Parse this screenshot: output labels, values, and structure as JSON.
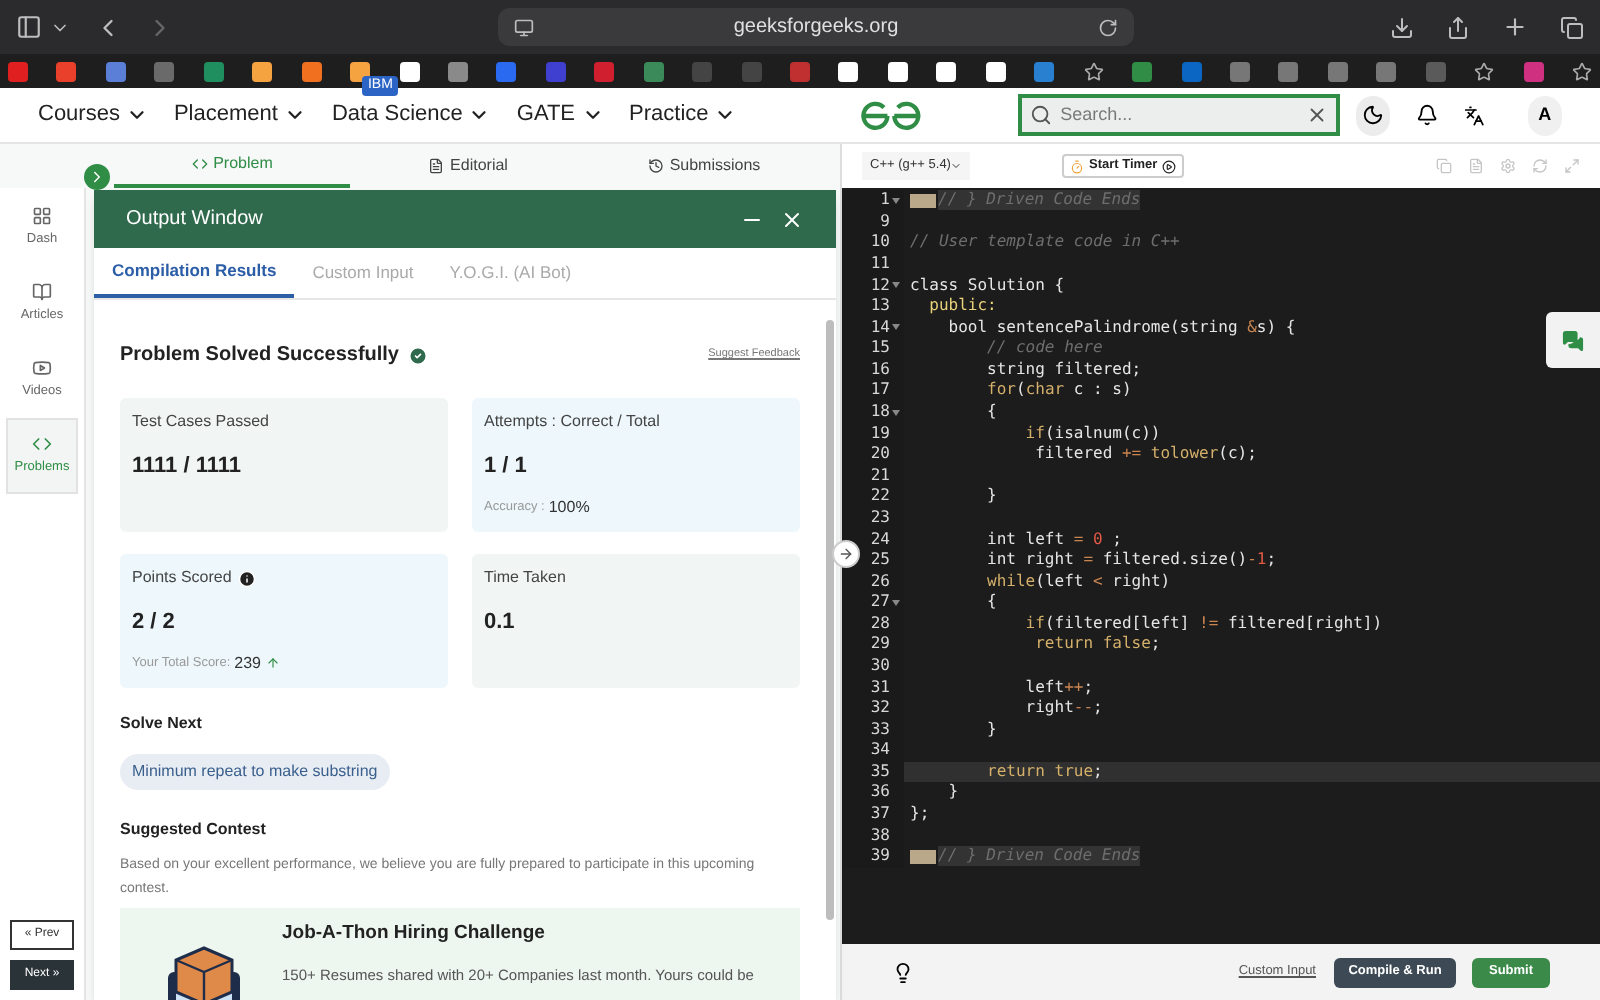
{
  "browser": {
    "url": "geeksforgeeks.org"
  },
  "nav": {
    "items": [
      {
        "label": "Courses"
      },
      {
        "label": "Placement"
      },
      {
        "label": "Data Science",
        "badge": "IBM"
      },
      {
        "label": "GATE"
      },
      {
        "label": "Practice"
      }
    ],
    "search": {
      "placeholder": "Search..."
    },
    "avatar": "A"
  },
  "problem_tabs": [
    {
      "label": "Problem",
      "selected": true
    },
    {
      "label": "Editorial",
      "selected": false
    },
    {
      "label": "Submissions",
      "selected": false
    }
  ],
  "sidebar": {
    "items": [
      {
        "label": "Dash",
        "selected": false
      },
      {
        "label": "Articles",
        "selected": false
      },
      {
        "label": "Videos",
        "selected": false
      },
      {
        "label": "Problems",
        "selected": true
      }
    ],
    "prev": "« Prev",
    "next": "Next »"
  },
  "output_window": {
    "title": "Output Window",
    "tabs": [
      {
        "label": "Compilation Results",
        "selected": true
      },
      {
        "label": "Custom Input",
        "selected": false
      },
      {
        "label": "Y.O.G.I. (AI Bot)",
        "selected": false
      }
    ],
    "heading": "Problem Solved Successfully",
    "feedback_link": "Suggest Feedback",
    "cards": [
      {
        "title": "Test Cases Passed",
        "value": "1111 / 1111",
        "color": "#f1f5f4"
      },
      {
        "title": "Attempts : Correct / Total",
        "value": "1 / 1",
        "note_label": "Accuracy :",
        "note_value": "100%",
        "color": "#eef8fc"
      },
      {
        "title": "Points Scored",
        "value": "2 / 2",
        "note_label": "Your Total Score:",
        "note_value": "239",
        "color": "#eef8fc"
      },
      {
        "title": "Time Taken",
        "value": "0.1",
        "color": "#f1f5f4"
      }
    ],
    "solve_next": {
      "heading": "Solve Next",
      "chip": "Minimum repeat to make substring"
    },
    "contest": {
      "heading": "Suggested Contest",
      "description": "Based on your excellent performance, we believe you are fully prepared to participate in this upcoming contest.",
      "title": "Job-A-Thon Hiring Challenge",
      "text": "150+ Resumes shared with 20+ Companies last month. Yours could be"
    }
  },
  "editor": {
    "language": "C++ (g++ 5.4)",
    "timer_button": "Start Timer",
    "lines": [
      {
        "number": "1",
        "fold": true,
        "folded": true,
        "current": false,
        "segments": [
          {
            "kind": "comment",
            "text": "// } Driven Code Ends"
          }
        ]
      },
      {
        "number": "9",
        "fold": false,
        "folded": false,
        "current": false
      },
      {
        "number": "10",
        "fold": false,
        "folded": false,
        "current": false,
        "segments": [
          {
            "kind": "comment",
            "text": "// User template code in C++"
          }
        ]
      },
      {
        "number": "11",
        "fold": false,
        "folded": false,
        "current": false
      },
      {
        "number": "12",
        "fold": true,
        "folded": false,
        "current": false,
        "segments": [
          {
            "kind": "text",
            "text": "class Solution {"
          }
        ]
      },
      {
        "number": "13",
        "fold": false,
        "folded": false,
        "current": false,
        "segments": [
          {
            "kind": "label",
            "text": "  public:"
          }
        ]
      },
      {
        "number": "14",
        "fold": true,
        "folded": false,
        "current": false,
        "segments": [
          {
            "kind": "text",
            "text": "    bool sentencePalindrome(string "
          },
          {
            "kind": "op",
            "text": "&"
          },
          {
            "kind": "text",
            "text": "s) {"
          }
        ]
      },
      {
        "number": "15",
        "fold": false,
        "folded": false,
        "current": false,
        "segments": [
          {
            "kind": "comment",
            "text": "        // code here"
          }
        ]
      },
      {
        "number": "16",
        "fold": false,
        "folded": false,
        "current": false,
        "segments": [
          {
            "kind": "text",
            "text": "        string filtered;"
          }
        ]
      },
      {
        "number": "17",
        "fold": false,
        "folded": false,
        "current": false,
        "segments": [
          {
            "kind": "keyword",
            "text": "        for"
          },
          {
            "kind": "text",
            "text": "("
          },
          {
            "kind": "keyword",
            "text": "char"
          },
          {
            "kind": "text",
            "text": " c : s)"
          }
        ]
      },
      {
        "number": "18",
        "fold": true,
        "folded": false,
        "current": false,
        "segments": [
          {
            "kind": "text",
            "text": "        {"
          }
        ]
      },
      {
        "number": "19",
        "fold": false,
        "folded": false,
        "current": false,
        "segments": [
          {
            "kind": "keyword",
            "text": "            if"
          },
          {
            "kind": "text",
            "text": "(isalnum(c))"
          }
        ]
      },
      {
        "number": "20",
        "fold": false,
        "folded": false,
        "current": false,
        "segments": [
          {
            "kind": "text",
            "text": "             filtered "
          },
          {
            "kind": "op",
            "text": "+= "
          },
          {
            "kind": "keyword",
            "text": "tolower"
          },
          {
            "kind": "text",
            "text": "(c);"
          }
        ]
      },
      {
        "number": "21",
        "fold": false,
        "folded": false,
        "current": false
      },
      {
        "number": "22",
        "fold": false,
        "folded": false,
        "current": false,
        "segments": [
          {
            "kind": "text",
            "text": "        }"
          }
        ]
      },
      {
        "number": "23",
        "fold": false,
        "folded": false,
        "current": false
      },
      {
        "number": "24",
        "fold": false,
        "folded": false,
        "current": false,
        "segments": [
          {
            "kind": "text",
            "text": "        int left "
          },
          {
            "kind": "op",
            "text": "= "
          },
          {
            "kind": "number",
            "text": "0"
          },
          {
            "kind": "text",
            "text": " ;"
          }
        ]
      },
      {
        "number": "25",
        "fold": false,
        "folded": false,
        "current": false,
        "segments": [
          {
            "kind": "text",
            "text": "        int right "
          },
          {
            "kind": "op",
            "text": "="
          },
          {
            "kind": "text",
            "text": " filtered.size()"
          },
          {
            "kind": "op",
            "text": "-"
          },
          {
            "kind": "number",
            "text": "1"
          },
          {
            "kind": "text",
            "text": ";"
          }
        ]
      },
      {
        "number": "26",
        "fold": false,
        "folded": false,
        "current": false,
        "segments": [
          {
            "kind": "keyword",
            "text": "        while"
          },
          {
            "kind": "text",
            "text": "(left "
          },
          {
            "kind": "op",
            "text": "<"
          },
          {
            "kind": "text",
            "text": " right)"
          }
        ]
      },
      {
        "number": "27",
        "fold": true,
        "folded": false,
        "current": false,
        "segments": [
          {
            "kind": "text",
            "text": "        {"
          }
        ]
      },
      {
        "number": "28",
        "fold": false,
        "folded": false,
        "current": false,
        "segments": [
          {
            "kind": "keyword",
            "text": "            if"
          },
          {
            "kind": "text",
            "text": "(filtered[left] "
          },
          {
            "kind": "op",
            "text": "!="
          },
          {
            "kind": "text",
            "text": " filtered[right])"
          }
        ]
      },
      {
        "number": "29",
        "fold": false,
        "folded": false,
        "current": false,
        "segments": [
          {
            "kind": "keyword",
            "text": "             return false"
          },
          {
            "kind": "text",
            "text": ";"
          }
        ]
      },
      {
        "number": "30",
        "fold": false,
        "folded": false,
        "current": false
      },
      {
        "number": "31",
        "fold": false,
        "folded": false,
        "current": false,
        "segments": [
          {
            "kind": "text",
            "text": "            left"
          },
          {
            "kind": "op",
            "text": "++"
          },
          {
            "kind": "text",
            "text": ";"
          }
        ]
      },
      {
        "number": "32",
        "fold": false,
        "folded": false,
        "current": false,
        "segments": [
          {
            "kind": "text",
            "text": "            right"
          },
          {
            "kind": "op",
            "text": "--"
          },
          {
            "kind": "text",
            "text": ";"
          }
        ]
      },
      {
        "number": "33",
        "fold": false,
        "folded": false,
        "current": false,
        "segments": [
          {
            "kind": "text",
            "text": "        }"
          }
        ]
      },
      {
        "number": "34",
        "fold": false,
        "folded": false,
        "current": false
      },
      {
        "number": "35",
        "fold": false,
        "folded": false,
        "current": true,
        "segments": [
          {
            "kind": "keyword",
            "text": "        return true"
          },
          {
            "kind": "text",
            "text": ";"
          }
        ]
      },
      {
        "number": "36",
        "fold": false,
        "folded": false,
        "current": false,
        "segments": [
          {
            "kind": "text",
            "text": "    }"
          }
        ]
      },
      {
        "number": "37",
        "fold": false,
        "folded": false,
        "current": false,
        "segments": [
          {
            "kind": "text",
            "text": "};"
          }
        ]
      },
      {
        "number": "38",
        "fold": false,
        "folded": false,
        "current": false
      },
      {
        "number": "39",
        "fold": false,
        "folded": true,
        "current": false,
        "segments": [
          {
            "kind": "comment",
            "text": "// } Driven Code Ends"
          }
        ]
      }
    ],
    "custom_input": "Custom Input",
    "compile": "Compile & Run",
    "submit": "Submit"
  }
}
